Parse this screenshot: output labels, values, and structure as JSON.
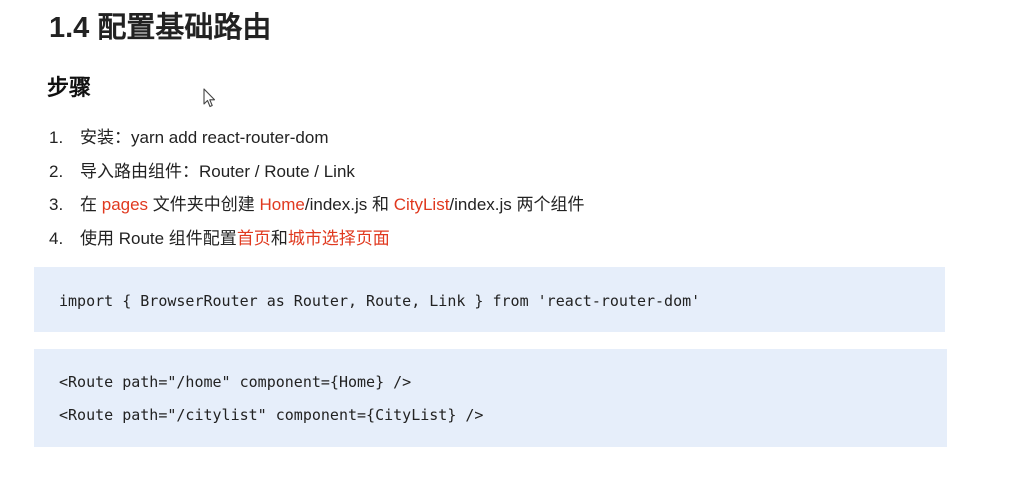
{
  "title": "1.4 配置基础路由",
  "subtitle": "步骤",
  "steps": [
    {
      "num": "1.",
      "parts": [
        {
          "text": "安装：yarn add react-router-dom",
          "hl": false
        }
      ]
    },
    {
      "num": "2.",
      "parts": [
        {
          "text": "导入路由组件：Router / Route / Link",
          "hl": false
        }
      ]
    },
    {
      "num": "3.",
      "parts": [
        {
          "text": "在 ",
          "hl": false
        },
        {
          "text": "pages",
          "hl": true
        },
        {
          "text": " 文件夹中创建 ",
          "hl": false
        },
        {
          "text": "Home",
          "hl": true
        },
        {
          "text": "/index.js 和 ",
          "hl": false
        },
        {
          "text": "CityList",
          "hl": true
        },
        {
          "text": "/index.js 两个组件",
          "hl": false
        }
      ]
    },
    {
      "num": "4.",
      "parts": [
        {
          "text": "使用 Route 组件配置",
          "hl": false
        },
        {
          "text": "首页",
          "hl": true
        },
        {
          "text": "和",
          "hl": false
        },
        {
          "text": "城市选择页面",
          "hl": true
        }
      ]
    }
  ],
  "code_blocks": [
    [
      "import { BrowserRouter as Router, Route, Link } from 'react-router-dom'"
    ],
    [
      "<Route path=\"/home\" component={Home} />",
      "<Route path=\"/citylist\" component={CityList} />"
    ]
  ],
  "colors": {
    "highlight": "#e0391f",
    "code_bg": "#e6eefa",
    "text": "#222222"
  },
  "icons": [
    "mouse-cursor-icon"
  ]
}
